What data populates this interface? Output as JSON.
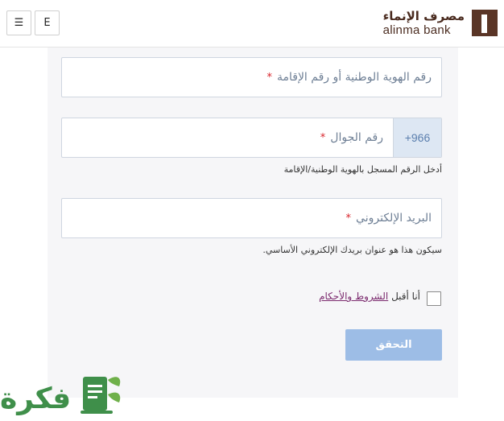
{
  "header": {
    "menu_icon": "☰",
    "lang_label": "E",
    "logo_ar": "مصرف الإنماء",
    "logo_en": "alinma bank",
    "logo_color": "#5a3526"
  },
  "form": {
    "id_field": {
      "placeholder": "رقم الهوية الوطنية أو رقم الإقامة",
      "required_mark": "*"
    },
    "phone_field": {
      "prefix": "+966",
      "placeholder": "رقم الجوال",
      "required_mark": "*",
      "hint": "أدخل الرقم المسجل بالهوية الوطنية/الإقامة"
    },
    "email_field": {
      "placeholder": "البريد الإلكتروني",
      "required_mark": "*",
      "hint": "سيكون هذا هو عنوان بريدك الإلكتروني الأساسي."
    },
    "terms": {
      "prefix": "أنا أقبل",
      "link": "الشروط والأحكام",
      "checked": false
    },
    "verify_button": {
      "label": "التحقق",
      "color": "#9dbde6"
    }
  },
  "watermark": {
    "text": "فكرة",
    "color": "#3f8f4a"
  }
}
